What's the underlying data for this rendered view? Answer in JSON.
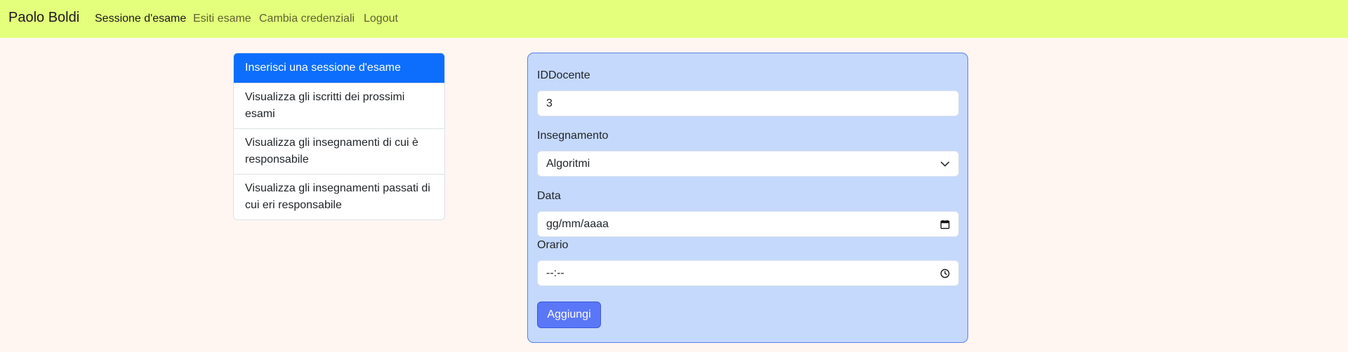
{
  "navbar": {
    "brand": "Paolo Boldi",
    "links": [
      {
        "label": "Sessione d'esame",
        "active": true
      },
      {
        "label": "Esiti esame",
        "active": false
      },
      {
        "label": "Cambia credenziali",
        "active": false
      },
      {
        "label": "Logout",
        "active": false
      }
    ],
    "background": "#e3ff7c"
  },
  "sidebar": {
    "items": [
      {
        "label": "Inserisci una sessione d'esame",
        "active": true
      },
      {
        "label": "Visualizza gli iscritti dei prossimi esami",
        "active": false
      },
      {
        "label": "Visualizza gli insegnamenti di cui è responsabile",
        "active": false
      },
      {
        "label": "Visualizza gli insegnamenti passati di cui eri responsabile",
        "active": false
      }
    ],
    "active_color": "#0d6efd"
  },
  "form": {
    "iddocente": {
      "label": "IDDocente",
      "value": "3"
    },
    "insegnamento": {
      "label": "Insegnamento",
      "value": "Algoritmi"
    },
    "data": {
      "label": "Data",
      "placeholder": "gg/mm/aaaa"
    },
    "orario": {
      "label": "Orario",
      "placeholder": "--:--"
    },
    "submit_label": "Aggiungi",
    "background": "#c5d9fc",
    "button_color": "#5a77f8"
  }
}
